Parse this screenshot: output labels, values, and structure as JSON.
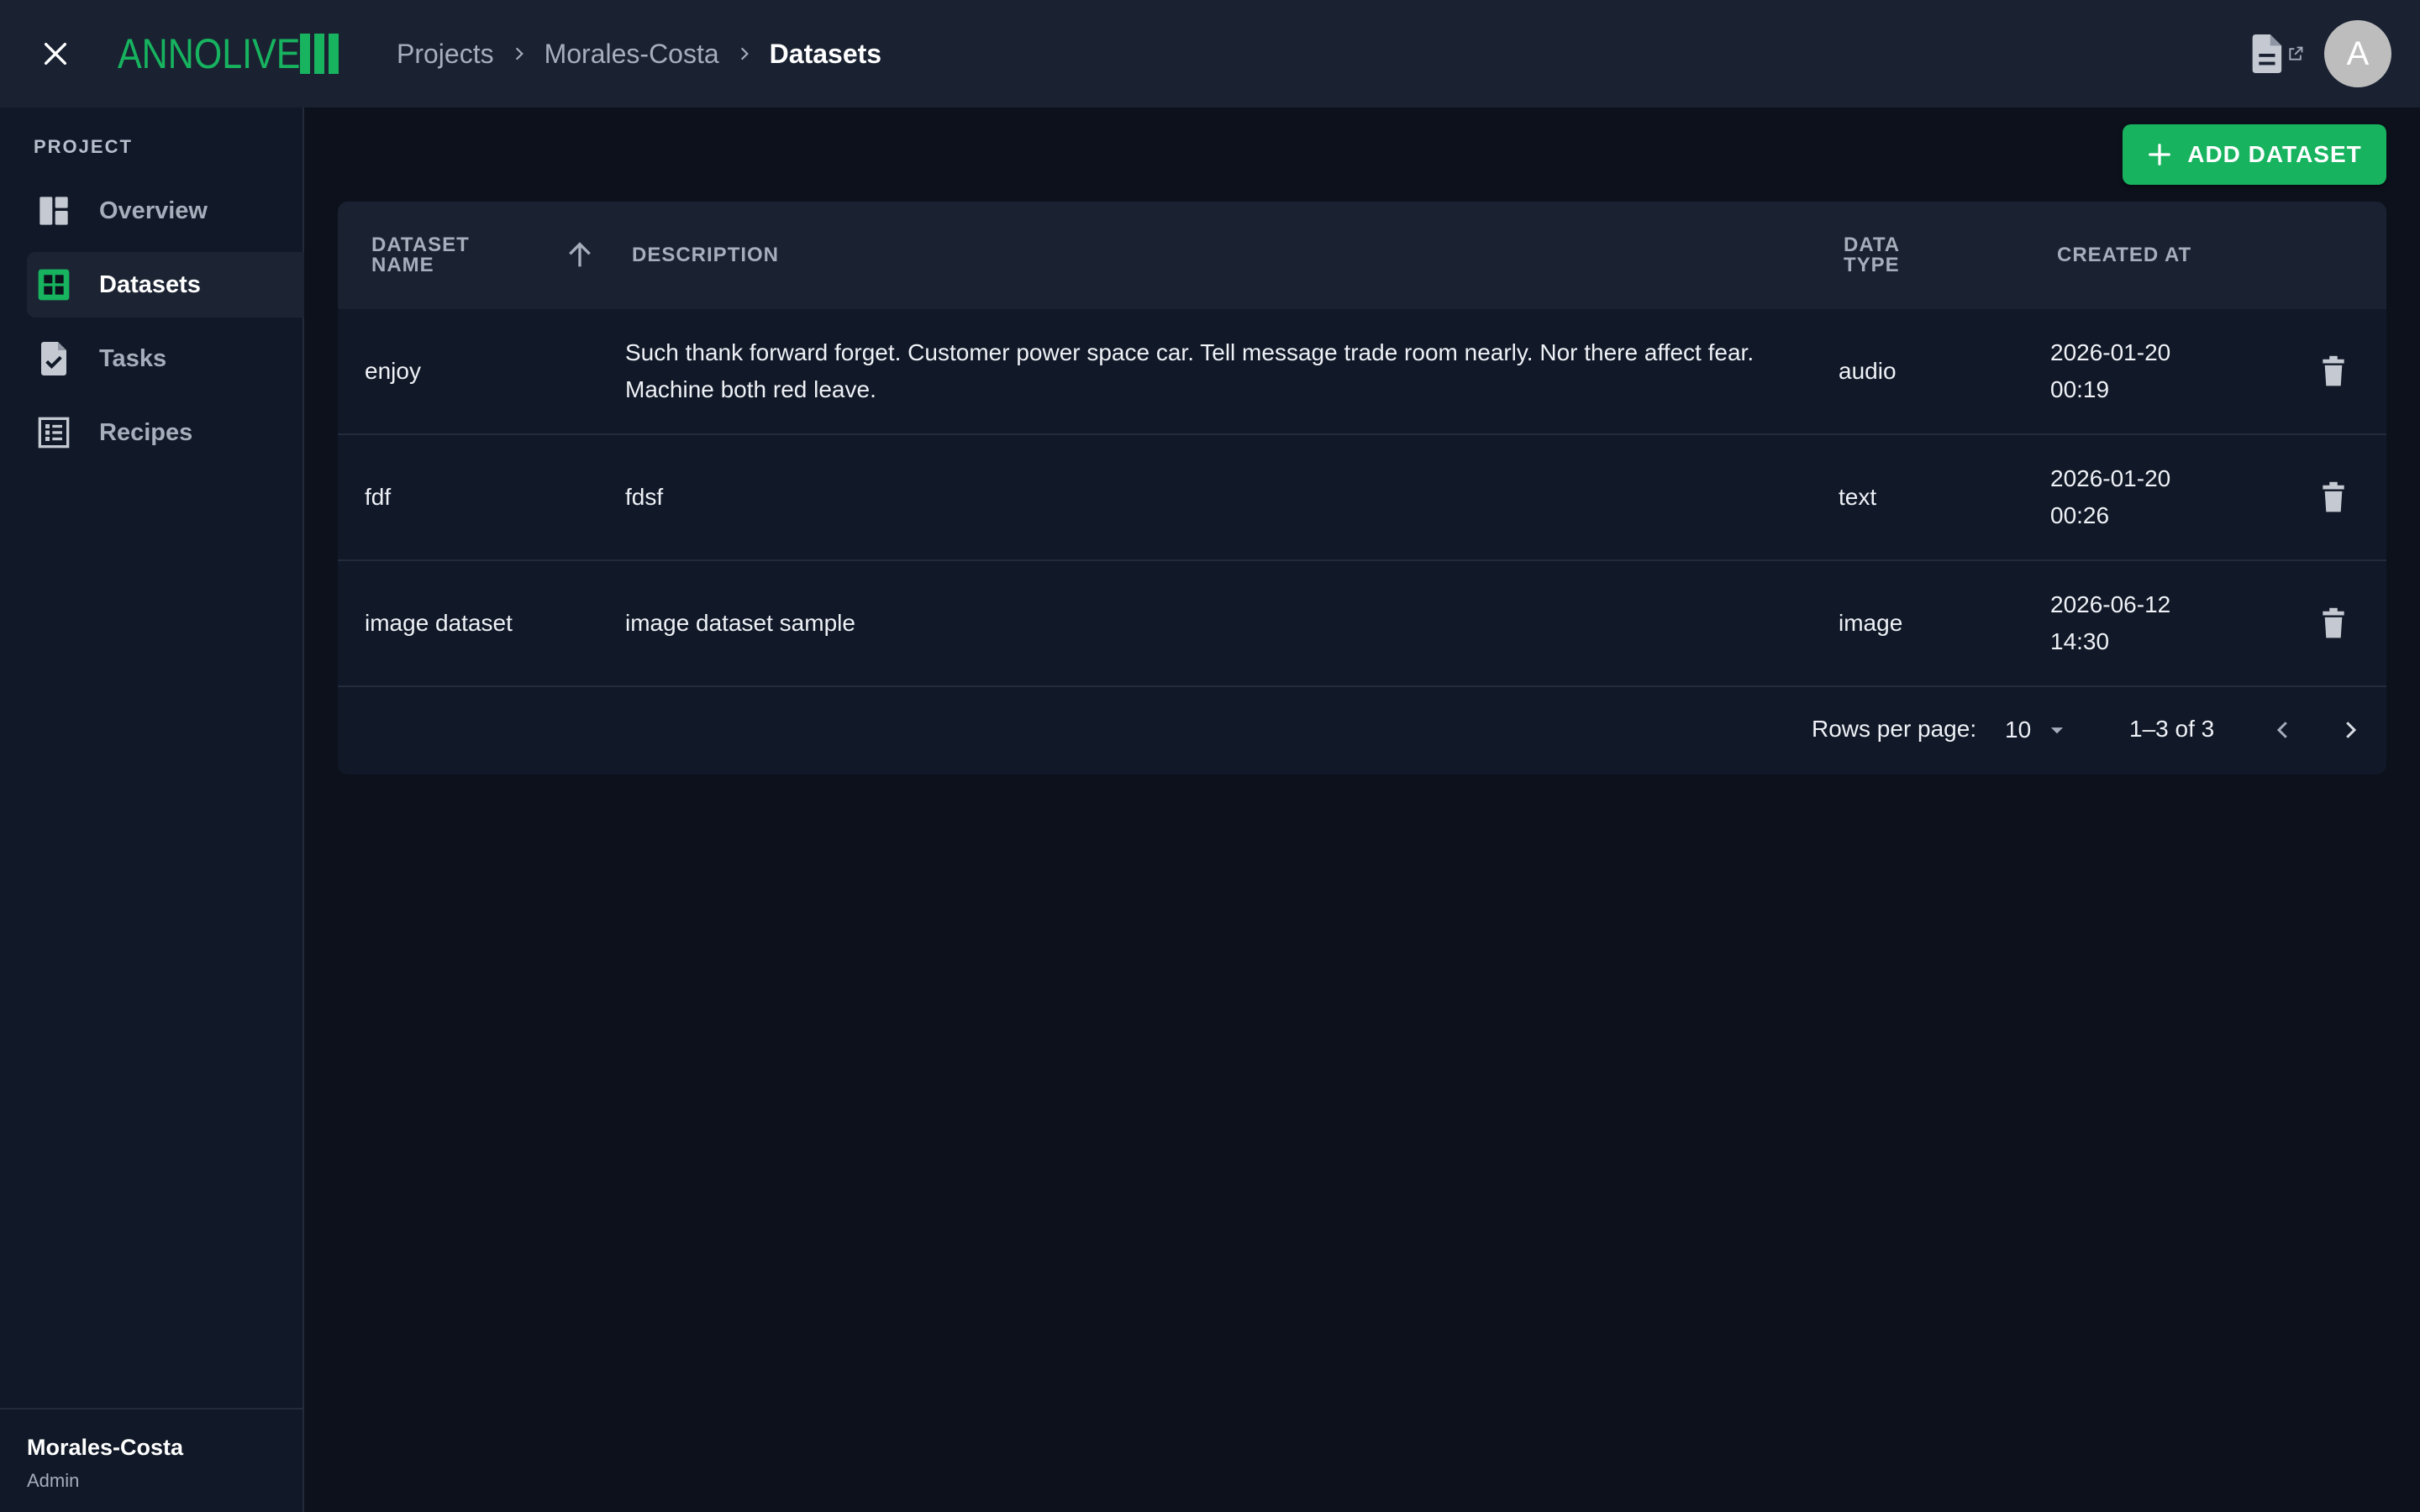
{
  "app": {
    "brand": "ANNOLIVE",
    "accent_color": "#17b35f",
    "close_icon": "close-icon",
    "docs_icon": "document-icon",
    "external_icon": "external-link-icon",
    "avatar_initial": "A"
  },
  "breadcrumb": {
    "items": [
      {
        "label": "Projects"
      },
      {
        "label": "Morales-Costa"
      },
      {
        "label": "Datasets"
      }
    ]
  },
  "sidebar": {
    "heading": "PROJECT",
    "items": [
      {
        "label": "Overview",
        "icon": "dashboard-icon",
        "active": false
      },
      {
        "label": "Datasets",
        "icon": "grid-icon",
        "active": true
      },
      {
        "label": "Tasks",
        "icon": "task-file-icon",
        "active": false
      },
      {
        "label": "Recipes",
        "icon": "list-icon",
        "active": false
      }
    ],
    "footer": {
      "name": "Morales-Costa",
      "role": "Admin"
    }
  },
  "toolbar": {
    "add_label": "ADD DATASET"
  },
  "table": {
    "columns": {
      "name_line1": "DATASET",
      "name_line2": "NAME",
      "description": "DESCRIPTION",
      "type_line1": "DATA",
      "type_line2": "TYPE",
      "created": "CREATED AT"
    },
    "rows": [
      {
        "name": "enjoy",
        "description": "Such thank forward forget. Customer power space car. Tell message trade room nearly. Nor there affect fear. Machine both red leave.",
        "type": "audio",
        "date": "2026-01-20",
        "time": "00:19"
      },
      {
        "name": "fdf",
        "description": "fdsf",
        "type": "text",
        "date": "2026-01-20",
        "time": "00:26"
      },
      {
        "name": "image dataset",
        "description": "image dataset sample",
        "type": "image",
        "date": "2026-06-12",
        "time": "14:30"
      }
    ]
  },
  "pagination": {
    "rows_per_page_label": "Rows per page:",
    "rows_per_page": "10",
    "range": "1–3 of 3"
  }
}
